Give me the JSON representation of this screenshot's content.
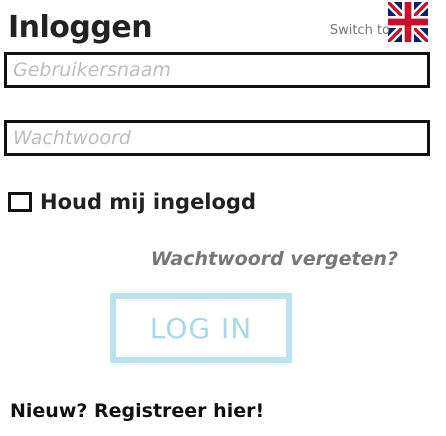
{
  "header": {
    "title": "Inloggen",
    "switch_text": "Switch to",
    "flag_icon": "uk-flag-icon"
  },
  "form": {
    "username_placeholder": "Gebruikersnaam",
    "username_value": "",
    "password_placeholder": "Wachtwoord",
    "password_value": "",
    "remember_label": "Houd mij ingelogd",
    "remember_checked": false,
    "forgot_link": "Wachtwoord vergeten?",
    "login_button": "LOG IN"
  },
  "footer": {
    "register_link": "Nieuw? Registreer hier!"
  },
  "colors": {
    "login_border": "#b7e4ef",
    "login_text": "#a9d9e6",
    "muted_text": "#777777"
  }
}
